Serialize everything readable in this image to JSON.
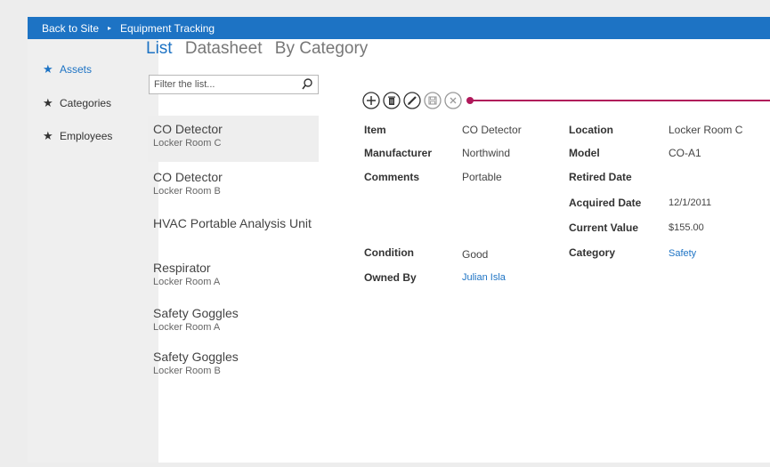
{
  "breadcrumb": {
    "back": "Back to Site",
    "separator": "▸",
    "current": "Equipment Tracking"
  },
  "nav": {
    "items": [
      {
        "label": "Assets",
        "active": true
      },
      {
        "label": "Categories",
        "active": false
      },
      {
        "label": "Employees",
        "active": false
      }
    ]
  },
  "views": {
    "tabs": [
      "List",
      "Datasheet",
      "By Category"
    ],
    "selected": "List"
  },
  "search": {
    "placeholder": "Filter the list...",
    "value": ""
  },
  "list": {
    "items": [
      {
        "title": "CO Detector",
        "subtitle": "Locker Room C",
        "selected": true
      },
      {
        "title": "CO Detector",
        "subtitle": "Locker Room B",
        "selected": false
      },
      {
        "title": "HVAC Portable Analysis Unit",
        "subtitle": "",
        "selected": false
      },
      {
        "title": "Respirator",
        "subtitle": "Locker Room A",
        "selected": false
      },
      {
        "title": "Safety Goggles",
        "subtitle": "Locker Room A",
        "selected": false
      },
      {
        "title": "Safety Goggles",
        "subtitle": "Locker Room B",
        "selected": false
      }
    ]
  },
  "toolbar": {
    "buttons": [
      "add-icon",
      "delete-icon",
      "edit-icon",
      "save-icon",
      "cancel-icon"
    ],
    "accent": "#b0185a"
  },
  "detail": {
    "left": [
      {
        "label": "Item",
        "value": "CO Detector"
      },
      {
        "label": "Manufacturer",
        "value": "Northwind"
      },
      {
        "label": "Comments",
        "value": "Portable"
      },
      {
        "label": "Condition",
        "value": "Good"
      },
      {
        "label": "Owned By",
        "value": "Julian Isla"
      }
    ],
    "right": [
      {
        "label": "Location",
        "value": "Locker Room C"
      },
      {
        "label": "Model",
        "value": "CO-A1"
      },
      {
        "label": "Retired Date",
        "value": ""
      },
      {
        "label": "Acquired Date",
        "value": "12/1/2011"
      },
      {
        "label": "Current Value",
        "value": "$155.00"
      },
      {
        "label": "Category",
        "value": "Safety"
      }
    ]
  },
  "colors": {
    "brand": "#1d73c4",
    "nav_bg": "#efefef",
    "selected_bg": "#eeeeee"
  }
}
